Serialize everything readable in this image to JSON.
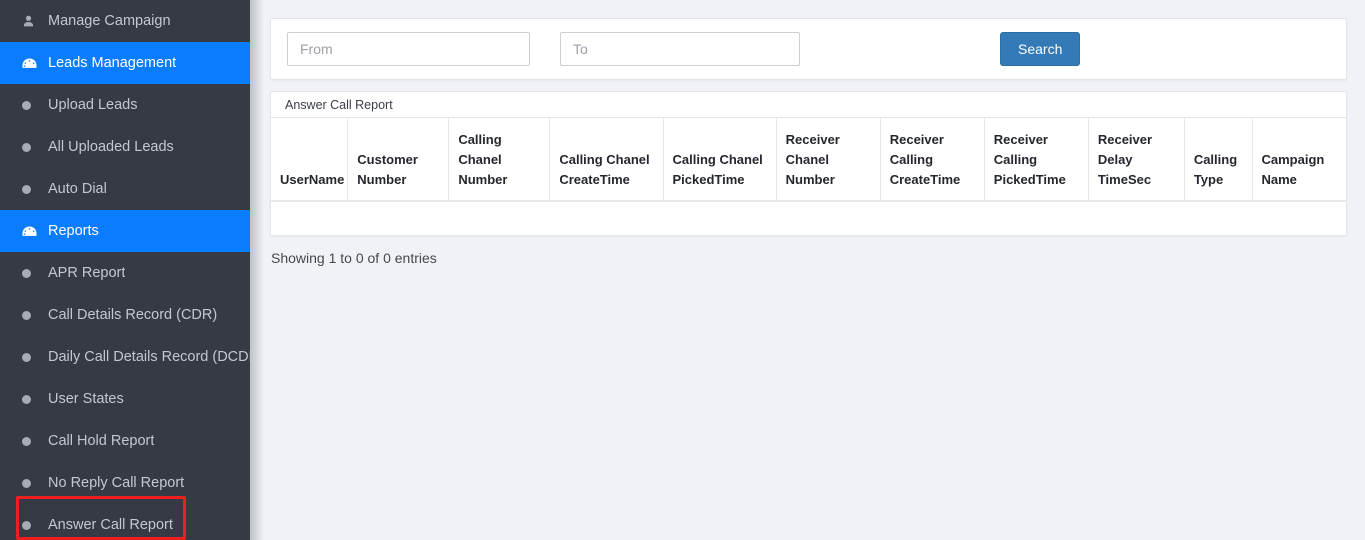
{
  "sidebar": {
    "items": [
      {
        "label": "Manage Campaign",
        "icon": "person-icon",
        "active": false,
        "highlighted": false
      },
      {
        "label": "Leads Management",
        "icon": "dashboard-icon",
        "active": true,
        "highlighted": false
      },
      {
        "label": "Upload Leads",
        "icon": "bullet-icon",
        "active": false,
        "highlighted": false
      },
      {
        "label": "All Uploaded Leads",
        "icon": "bullet-icon",
        "active": false,
        "highlighted": false
      },
      {
        "label": "Auto Dial",
        "icon": "bullet-icon",
        "active": false,
        "highlighted": false
      },
      {
        "label": "Reports",
        "icon": "dashboard-icon",
        "active": true,
        "highlighted": false
      },
      {
        "label": "APR Report",
        "icon": "bullet-icon",
        "active": false,
        "highlighted": false
      },
      {
        "label": "Call Details Record (CDR)",
        "icon": "bullet-icon",
        "active": false,
        "highlighted": false
      },
      {
        "label": "Daily Call Details Record (DCDR)",
        "icon": "bullet-icon",
        "active": false,
        "highlighted": false
      },
      {
        "label": "User States",
        "icon": "bullet-icon",
        "active": false,
        "highlighted": false
      },
      {
        "label": "Call Hold Report",
        "icon": "bullet-icon",
        "active": false,
        "highlighted": false
      },
      {
        "label": "No Reply Call Report",
        "icon": "bullet-icon",
        "active": false,
        "highlighted": false
      },
      {
        "label": "Answer Call Report",
        "icon": "bullet-icon",
        "active": false,
        "highlighted": true
      }
    ]
  },
  "search": {
    "from_value": "",
    "from_placeholder": "From",
    "to_value": "",
    "to_placeholder": "To",
    "search_label": "Search"
  },
  "report": {
    "panel_title": "Answer Call Report",
    "columns": [
      "UserName",
      "Customer Number",
      "Calling Chanel Number",
      "Calling Chanel CreateTime",
      "Calling Chanel PickedTime",
      "Receiver Chanel Number",
      "Receiver Calling CreateTime",
      "Receiver Calling PickedTime",
      "Receiver Delay TimeSec",
      "Calling Type",
      "Campaign Name"
    ],
    "rows": [],
    "entries_info": "Showing 1 to 0 of 0 entries"
  },
  "colors": {
    "sidebar_bg": "#353a45",
    "sidebar_active": "#0a7cff",
    "search_button": "#337ab7",
    "highlight_border": "#f01f1f",
    "content_bg": "#f0f2f7"
  }
}
